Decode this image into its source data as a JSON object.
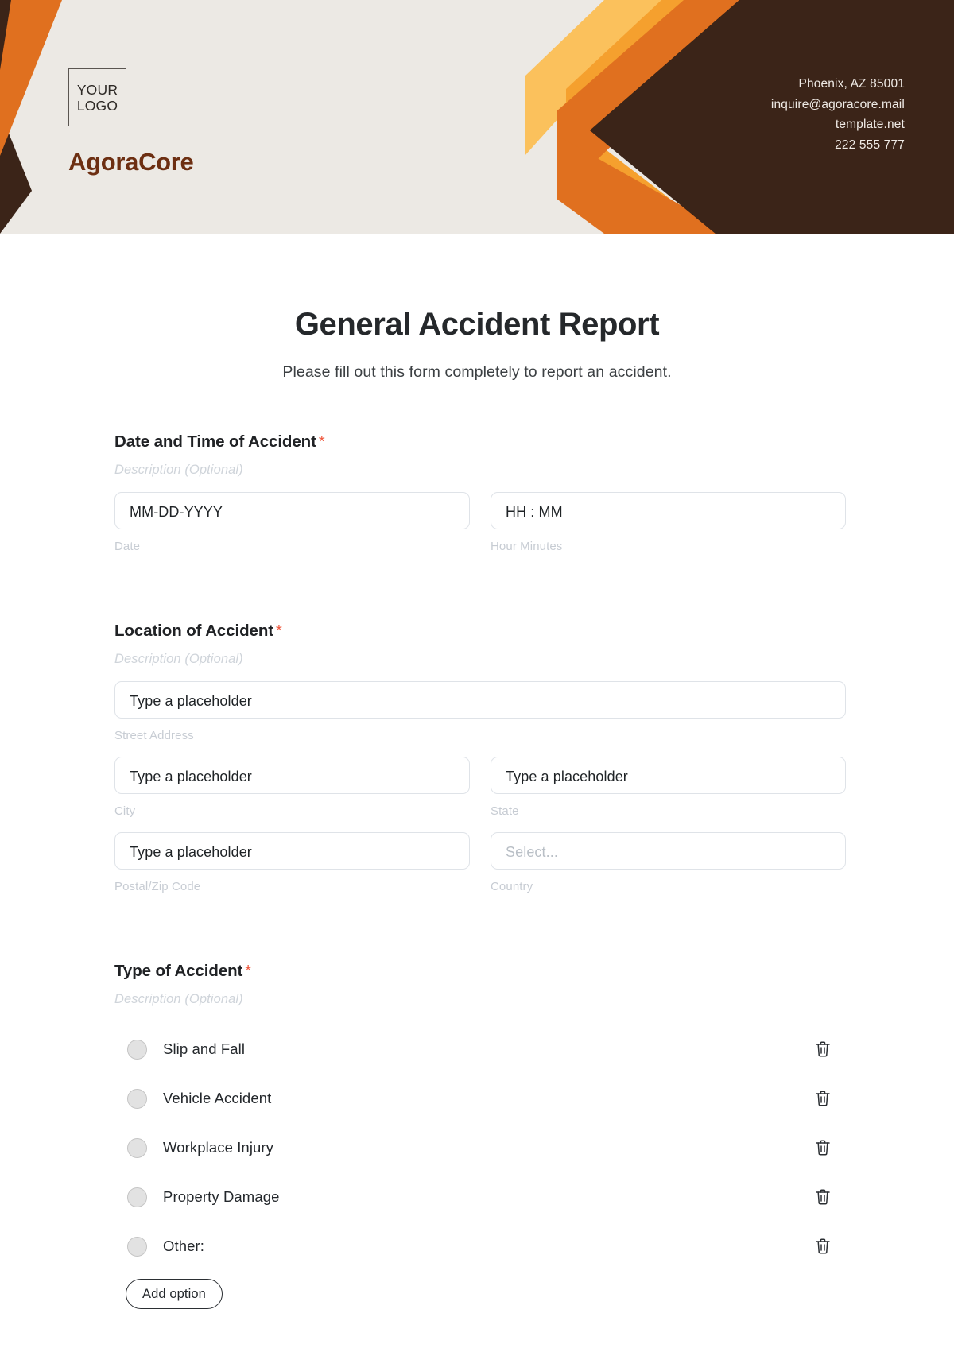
{
  "header": {
    "logo": {
      "line1": "YOUR",
      "line2": "LOGO",
      "brand": "AgoraCore"
    },
    "contact": [
      "Phoenix, AZ 85001",
      "inquire@agoracore.mail",
      "template.net",
      "222 555 777"
    ],
    "colors": {
      "background": "#ece9e4",
      "dark_brown": "#3b2418",
      "orange": "#e0701f",
      "amber": "#f5a02e",
      "light_amber": "#fbc15c",
      "brand_text": "#6d2f12"
    }
  },
  "form": {
    "title": "General Accident Report",
    "subtitle": "Please fill out this form completely to report an accident.",
    "required_marker": "*",
    "description_placeholder": "Description (Optional)",
    "sections": [
      {
        "label": "Date and Time of Accident",
        "required": true,
        "description": "Description (Optional)",
        "fields": [
          {
            "placeholder": "MM-DD-YYYY",
            "sub_label": "Date",
            "type": "text"
          },
          {
            "placeholder": "HH : MM",
            "sub_label": "Hour Minutes",
            "type": "text"
          }
        ]
      },
      {
        "label": "Location of Accident",
        "required": true,
        "description": "Description (Optional)",
        "fields": [
          {
            "placeholder": "Type a placeholder",
            "sub_label": "Street Address",
            "type": "text"
          },
          {
            "placeholder": "Type a placeholder",
            "sub_label": "City",
            "type": "text"
          },
          {
            "placeholder": "Type a placeholder",
            "sub_label": "State",
            "type": "text"
          },
          {
            "placeholder": "Type a placeholder",
            "sub_label": "Postal/Zip Code",
            "type": "text"
          },
          {
            "placeholder": "Select...",
            "sub_label": "Country",
            "type": "select"
          }
        ]
      },
      {
        "label": "Type of Accident",
        "required": true,
        "description": "Description (Optional)",
        "options": [
          "Slip and Fall",
          "Vehicle Accident",
          "Workplace Injury",
          "Property Damage",
          "Other:"
        ],
        "add_option_label": "Add option",
        "delete_icon": "trash-icon",
        "option_control": "radio-button"
      }
    ]
  }
}
